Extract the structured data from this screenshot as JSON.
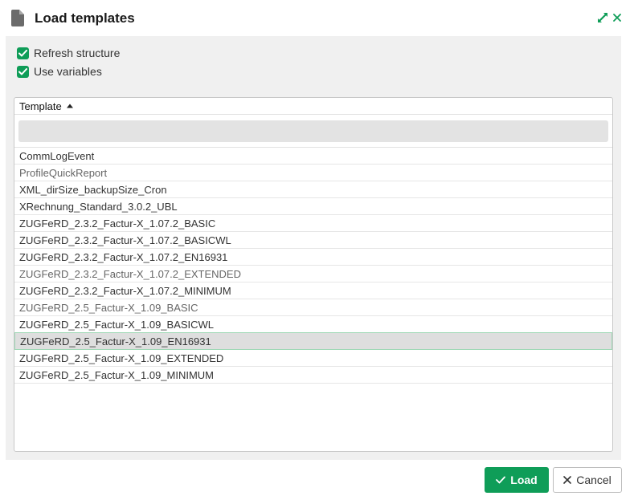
{
  "dialog": {
    "title": "Load templates",
    "icons": {
      "document": "document-icon",
      "expand": "expand-icon",
      "close": "close-icon"
    },
    "colors": {
      "accent": "#0f9d58",
      "panel": "#f0f0f0",
      "selected_row": "#dedede"
    }
  },
  "options": {
    "refresh_structure": {
      "label": "Refresh structure",
      "checked": true
    },
    "use_variables": {
      "label": "Use variables",
      "checked": true
    }
  },
  "grid": {
    "column": "Template",
    "sort": "ascending",
    "filter_value": "",
    "rows": [
      "CommLogEvent",
      "ProfileQuickReport",
      "XML_dirSize_backupSize_Cron",
      "XRechnung_Standard_3.0.2_UBL",
      "ZUGFeRD_2.3.2_Factur-X_1.07.2_BASIC",
      "ZUGFeRD_2.3.2_Factur-X_1.07.2_BASICWL",
      "ZUGFeRD_2.3.2_Factur-X_1.07.2_EN16931",
      "ZUGFeRD_2.3.2_Factur-X_1.07.2_EXTENDED",
      "ZUGFeRD_2.3.2_Factur-X_1.07.2_MINIMUM",
      "ZUGFeRD_2.5_Factur-X_1.09_BASIC",
      "ZUGFeRD_2.5_Factur-X_1.09_BASICWL",
      "ZUGFeRD_2.5_Factur-X_1.09_EN16931",
      "ZUGFeRD_2.5_Factur-X_1.09_EXTENDED",
      "ZUGFeRD_2.5_Factur-X_1.09_MINIMUM"
    ],
    "selected_index": 11
  },
  "buttons": {
    "load": "Load",
    "cancel": "Cancel"
  }
}
